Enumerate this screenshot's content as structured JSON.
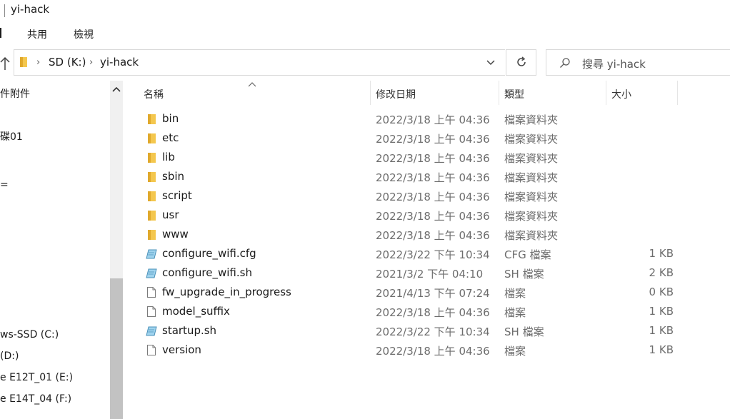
{
  "window": {
    "title": "yi-hack"
  },
  "ribbon": {
    "tabs": [
      "共用",
      "檢視"
    ]
  },
  "address": {
    "crumbs": [
      "SD (K:)",
      "yi-hack"
    ]
  },
  "search": {
    "placeholder": "搜尋 yi-hack"
  },
  "nav": {
    "items": [
      "件附件",
      "碟01",
      "=",
      "ws-SSD (C:)",
      "(D:)",
      "e E12T_01 (E:)",
      "e E14T_04 (F:)"
    ]
  },
  "columns": {
    "name": "名稱",
    "date": "修改日期",
    "type": "類型",
    "size": "大小"
  },
  "files": [
    {
      "icon": "folder-icon",
      "name": "bin",
      "date": "2022/3/18 上午 04:36",
      "type": "檔案資料夾",
      "size": ""
    },
    {
      "icon": "folder-icon",
      "name": "etc",
      "date": "2022/3/18 上午 04:36",
      "type": "檔案資料夾",
      "size": ""
    },
    {
      "icon": "folder-icon",
      "name": "lib",
      "date": "2022/3/18 上午 04:36",
      "type": "檔案資料夾",
      "size": ""
    },
    {
      "icon": "folder-icon",
      "name": "sbin",
      "date": "2022/3/18 上午 04:36",
      "type": "檔案資料夾",
      "size": ""
    },
    {
      "icon": "folder-icon",
      "name": "script",
      "date": "2022/3/18 上午 04:36",
      "type": "檔案資料夾",
      "size": ""
    },
    {
      "icon": "folder-icon",
      "name": "usr",
      "date": "2022/3/18 上午 04:36",
      "type": "檔案資料夾",
      "size": ""
    },
    {
      "icon": "folder-icon",
      "name": "www",
      "date": "2022/3/18 上午 04:36",
      "type": "檔案資料夾",
      "size": ""
    },
    {
      "icon": "script-file-icon",
      "name": "configure_wifi.cfg",
      "date": "2022/3/22 下午 10:34",
      "type": "CFG 檔案",
      "size": "1 KB"
    },
    {
      "icon": "script-file-icon",
      "name": "configure_wifi.sh",
      "date": "2021/3/2 下午 04:10",
      "type": "SH 檔案",
      "size": "2 KB"
    },
    {
      "icon": "blank-file-icon",
      "name": "fw_upgrade_in_progress",
      "date": "2021/4/13 下午 07:24",
      "type": "檔案",
      "size": "0 KB"
    },
    {
      "icon": "blank-file-icon",
      "name": "model_suffix",
      "date": "2022/3/18 上午 04:36",
      "type": "檔案",
      "size": "1 KB"
    },
    {
      "icon": "script-file-icon",
      "name": "startup.sh",
      "date": "2022/3/22 下午 10:34",
      "type": "SH 檔案",
      "size": "1 KB"
    },
    {
      "icon": "blank-file-icon",
      "name": "version",
      "date": "2022/3/18 上午 04:36",
      "type": "檔案",
      "size": "1 KB"
    }
  ],
  "colors": {
    "folder": "#f4c74e",
    "folder_dark": "#e0a92c",
    "muted_text": "#6d6d6d"
  }
}
